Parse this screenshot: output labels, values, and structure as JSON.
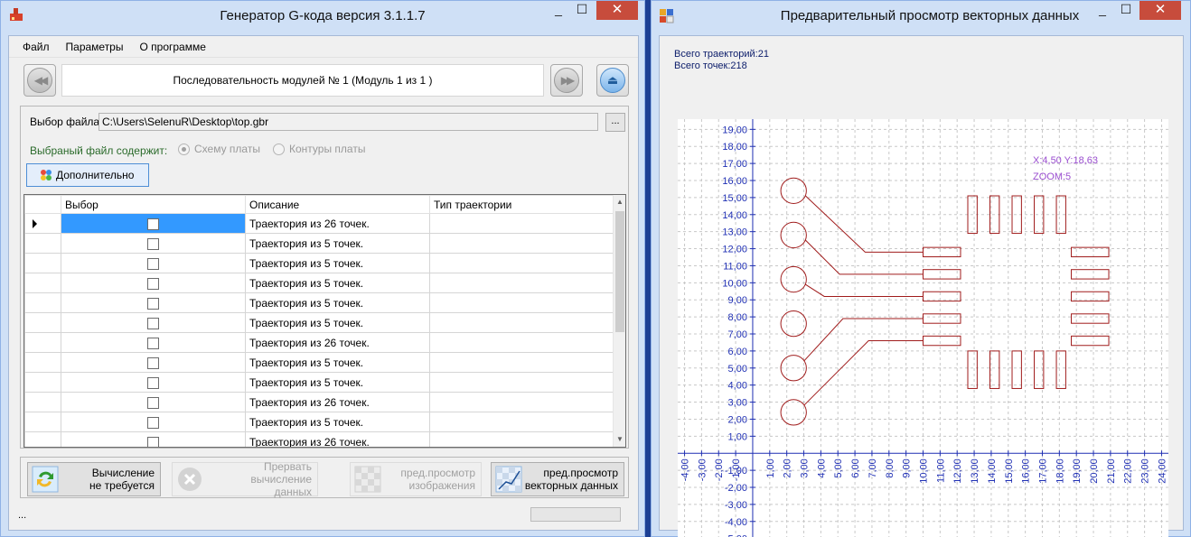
{
  "left_window": {
    "title": "Генератор G-кода версия 3.1.1.7",
    "close_glyph": "✕",
    "menu": [
      "Файл",
      "Параметры",
      "О программе"
    ],
    "sequence_label": "Последовательность модулей № 1 (Модуль 1 из 1 )",
    "nav": {
      "prev_glyph": "◀◀",
      "next_glyph": "▶▶",
      "eject_glyph": "⏏"
    },
    "file": {
      "label": "Выбор файла:",
      "path": "C:\\Users\\SelenuR\\Desktop\\top.gbr",
      "browse": "..."
    },
    "contains": {
      "label": "Выбраный файл содержит:",
      "options": [
        "Схему платы",
        "Контуры платы"
      ],
      "selected": 0
    },
    "advanced_label": "Дополнительно",
    "grid": {
      "headers": [
        "Выбор",
        "Описание",
        "Тип траектории"
      ],
      "rows": [
        "Траектория из 26 точек.",
        "Траектория из 5 точек.",
        "Траектория из 5 точек.",
        "Траектория из 5 точек.",
        "Траектория из 5 точек.",
        "Траектория из 5 точек.",
        "Траектория из 26 точек.",
        "Траектория из 5 точек.",
        "Траектория из 5 точек.",
        "Траектория из 26 точек.",
        "Траектория из 5 точек.",
        "Траектория из 26 точек."
      ]
    },
    "actions": [
      {
        "line1": "Вычисление",
        "line2": "не требуется",
        "enabled": true
      },
      {
        "line1": "Прервать вычисление",
        "line2": "данных",
        "enabled": false
      },
      {
        "line1": "пред.просмотр",
        "line2": "изображения",
        "enabled": false
      },
      {
        "line1": "пред.просмотр",
        "line2": "векторных данных",
        "enabled": true
      }
    ],
    "status_text": "..."
  },
  "right_window": {
    "title": "Предварительный просмотр векторных данных",
    "close_glyph": "✕",
    "total_paths": "Всего траекторий:21",
    "total_points": "Всего точек:218",
    "cursor_readout": "X:4,50 Y:18,63",
    "zoom_readout": "ZOOM:5",
    "colors": {
      "axis": "#1f2fb3",
      "trace": "#a01c1c",
      "grid": "#c8c8c8",
      "readout": "#9b4fd0"
    }
  },
  "chart_data": {
    "type": "vector-preview",
    "xlim": [
      -4.4,
      24.4
    ],
    "ylim": [
      -5.6,
      19.6
    ],
    "x_ticks": [
      -4,
      -3,
      -2,
      -1,
      1,
      2,
      3,
      4,
      5,
      6,
      7,
      8,
      9,
      10,
      11,
      12,
      13,
      14,
      15,
      16,
      17,
      18,
      19,
      20,
      21,
      22,
      23,
      24
    ],
    "y_ticks": [
      19,
      18,
      17,
      16,
      15,
      14,
      13,
      12,
      11,
      10,
      9,
      8,
      7,
      6,
      5,
      4,
      3,
      2,
      1,
      -1,
      -2,
      -3,
      -4,
      -5
    ],
    "circles": [
      {
        "cx": 2.4,
        "cy": 15.4,
        "r": 0.75
      },
      {
        "cx": 2.4,
        "cy": 12.8,
        "r": 0.75
      },
      {
        "cx": 2.4,
        "cy": 10.2,
        "r": 0.75
      },
      {
        "cx": 2.4,
        "cy": 7.6,
        "r": 0.75
      },
      {
        "cx": 2.4,
        "cy": 5.0,
        "r": 0.75
      },
      {
        "cx": 2.4,
        "cy": 2.4,
        "r": 0.75
      }
    ],
    "pads_h": [
      {
        "x0": 10.0,
        "x1": 12.2,
        "yc": 11.8,
        "h": 0.55
      },
      {
        "x0": 10.0,
        "x1": 12.2,
        "yc": 10.5,
        "h": 0.55
      },
      {
        "x0": 10.0,
        "x1": 12.2,
        "yc": 9.2,
        "h": 0.55
      },
      {
        "x0": 10.0,
        "x1": 12.2,
        "yc": 7.9,
        "h": 0.55
      },
      {
        "x0": 10.0,
        "x1": 12.2,
        "yc": 6.6,
        "h": 0.55
      },
      {
        "x0": 18.7,
        "x1": 20.9,
        "yc": 11.8,
        "h": 0.55
      },
      {
        "x0": 18.7,
        "x1": 20.9,
        "yc": 10.5,
        "h": 0.55
      },
      {
        "x0": 18.7,
        "x1": 20.9,
        "yc": 9.2,
        "h": 0.55
      },
      {
        "x0": 18.7,
        "x1": 20.9,
        "yc": 7.9,
        "h": 0.55
      },
      {
        "x0": 18.7,
        "x1": 20.9,
        "yc": 6.6,
        "h": 0.55
      }
    ],
    "pads_v": [
      {
        "xc": 12.9,
        "y0": 12.9,
        "y1": 15.1,
        "w": 0.55
      },
      {
        "xc": 14.2,
        "y0": 12.9,
        "y1": 15.1,
        "w": 0.55
      },
      {
        "xc": 15.5,
        "y0": 12.9,
        "y1": 15.1,
        "w": 0.55
      },
      {
        "xc": 16.8,
        "y0": 12.9,
        "y1": 15.1,
        "w": 0.55
      },
      {
        "xc": 18.1,
        "y0": 12.9,
        "y1": 15.1,
        "w": 0.55
      },
      {
        "xc": 12.9,
        "y0": 3.8,
        "y1": 6.0,
        "w": 0.55
      },
      {
        "xc": 14.2,
        "y0": 3.8,
        "y1": 6.0,
        "w": 0.55
      },
      {
        "xc": 15.5,
        "y0": 3.8,
        "y1": 6.0,
        "w": 0.55
      },
      {
        "xc": 16.8,
        "y0": 3.8,
        "y1": 6.0,
        "w": 0.55
      },
      {
        "xc": 18.1,
        "y0": 3.8,
        "y1": 6.0,
        "w": 0.55
      }
    ],
    "traces": [
      {
        "from": [
          3.1,
          15.1
        ],
        "mid": [
          6.6,
          11.8
        ],
        "to": [
          10.0,
          11.8
        ]
      },
      {
        "from": [
          3.1,
          12.5
        ],
        "mid": [
          5.1,
          10.5
        ],
        "to": [
          10.0,
          10.5
        ]
      },
      {
        "from": [
          3.1,
          9.9
        ],
        "mid": [
          4.2,
          9.2
        ],
        "to": [
          10.0,
          9.2
        ]
      },
      {
        "from": [
          3.0,
          5.4
        ],
        "mid": [
          5.3,
          7.9
        ],
        "to": [
          10.0,
          7.9
        ]
      },
      {
        "from": [
          3.0,
          2.8
        ],
        "mid": [
          6.8,
          6.6
        ],
        "to": [
          10.0,
          6.6
        ]
      }
    ],
    "grid": true
  }
}
